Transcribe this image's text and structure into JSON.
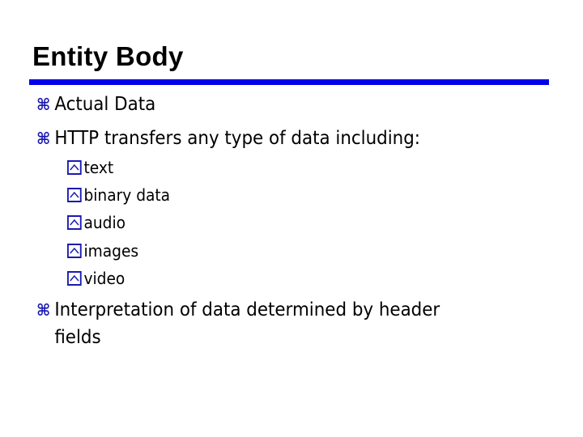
{
  "slide": {
    "title": "Entity Body",
    "bullets": [
      {
        "icon": "command-bullet-icon",
        "text": "Actual Data"
      },
      {
        "icon": "command-bullet-icon",
        "text": "HTTP transfers any type of data including:",
        "sub": [
          {
            "icon": "boxed-caret-bullet-icon",
            "text": "text"
          },
          {
            "icon": "boxed-caret-bullet-icon",
            "text": "binary data"
          },
          {
            "icon": "boxed-caret-bullet-icon",
            "text": "audio"
          },
          {
            "icon": "boxed-caret-bullet-icon",
            "text": "images"
          },
          {
            "icon": "boxed-caret-bullet-icon",
            "text": "video"
          }
        ]
      },
      {
        "icon": "command-bullet-icon",
        "text": "Interpretation of data determined by header",
        "text_cont": "fields"
      }
    ],
    "bullet_glyph": "⌘",
    "colors": {
      "rule": "#0000ee",
      "bullet": "#1a1ab0",
      "text": "#000000"
    }
  }
}
